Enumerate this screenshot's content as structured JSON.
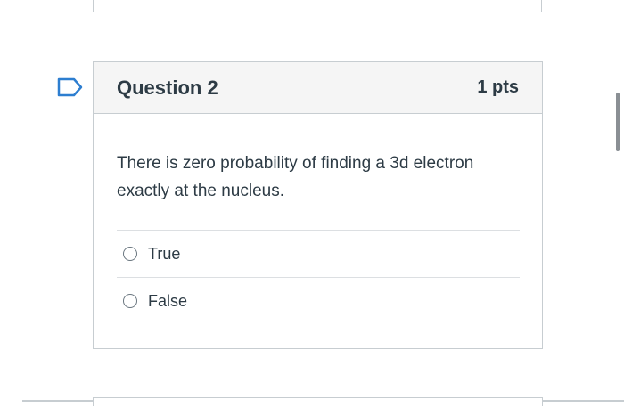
{
  "question": {
    "title": "Question 2",
    "points": "1 pts",
    "text": "There is zero probability of finding a 3d electron exactly at the nucleus.",
    "flag_icon": "flag-bookmark-icon"
  },
  "answers": [
    {
      "label": "True",
      "selected": false
    },
    {
      "label": "False",
      "selected": false
    }
  ],
  "colors": {
    "flag": "#2d7ed0",
    "header_bg": "#f5f5f5",
    "border": "#c7cdd1",
    "text": "#2d3b45"
  }
}
